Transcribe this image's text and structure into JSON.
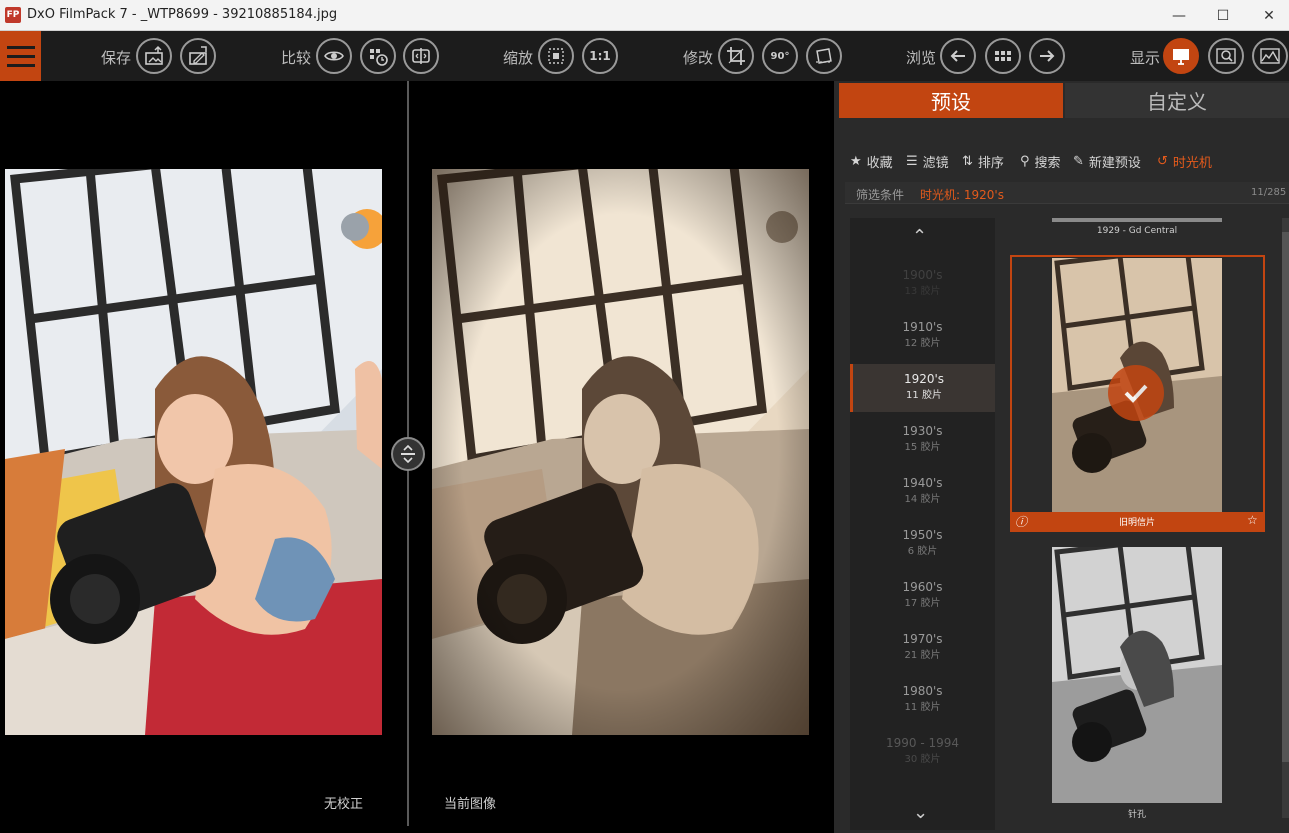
{
  "window": {
    "logo": "FP",
    "title": "DxO FilmPack 7 - _WTP8699 - 39210885184.jpg",
    "minimize": "—",
    "maximize": "☐",
    "close": "✕"
  },
  "toolbar": {
    "save_label": "保存",
    "compare_label": "比较",
    "zoom_label": "缩放",
    "zoom_100": "1:1",
    "edit_label": "修改",
    "rotate_label": "90°",
    "browse_label": "浏览",
    "display_label": "显示"
  },
  "viewer": {
    "before_label": "无校正",
    "after_label": "当前图像"
  },
  "panel": {
    "tabs": [
      "预设",
      "自定义"
    ],
    "active_tab": "预设",
    "actions": [
      "收藏",
      "滤镜",
      "排序",
      "搜索",
      "新建预设",
      "时光机"
    ],
    "active_action": "时光机",
    "filter_label": "筛选条件",
    "filter_value": "时光机: 1920's",
    "count": "11/285",
    "eras": [
      {
        "name": "1900's",
        "count": "13 胶片"
      },
      {
        "name": "1910's",
        "count": "12 胶片"
      },
      {
        "name": "1920's",
        "count": "11 胶片"
      },
      {
        "name": "1930's",
        "count": "15 胶片"
      },
      {
        "name": "1940's",
        "count": "14 胶片"
      },
      {
        "name": "1950's",
        "count": "6 胶片"
      },
      {
        "name": "1960's",
        "count": "17 胶片"
      },
      {
        "name": "1970's",
        "count": "21 胶片"
      },
      {
        "name": "1980's",
        "count": "11 胶片"
      },
      {
        "name": "1990 - 1994",
        "count": "30 胶片"
      }
    ],
    "selected_era": "1920's",
    "thumbnails": [
      {
        "name": "1929 - Gd Central"
      },
      {
        "name": "旧明信片",
        "selected": true
      },
      {
        "name": "针孔"
      }
    ]
  },
  "colors": {
    "accent": "#c24511",
    "toolbar_bg": "#1c1c1c",
    "panel_bg": "#2a2a2a"
  }
}
